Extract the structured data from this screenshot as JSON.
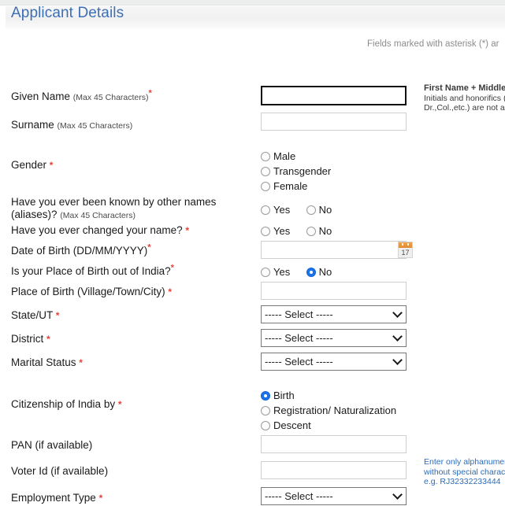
{
  "header": {
    "title": "Applicant Details",
    "asterisk_note": "Fields marked with asterisk (*) ar"
  },
  "hints": {
    "name_hint_title": "First Name + Middle N",
    "name_hint_line1": "Initials and honorifics (e",
    "name_hint_line2": "Dr.,Col.,etc.) are not all",
    "id_hint_line1": "Enter only alphanumeri",
    "id_hint_line2": "without special charact",
    "id_hint_line3": "e.g. RJ32332233444"
  },
  "select_placeholder": "----- Select -----",
  "fields": {
    "given_name": {
      "label": "Given Name",
      "sub": "(Max 45 Characters)",
      "required": true,
      "value": "",
      "focused": true
    },
    "surname": {
      "label": "Surname",
      "sub": "(Max 45 Characters)",
      "required": false,
      "value": ""
    },
    "gender": {
      "label": "Gender",
      "required": true,
      "options": [
        "Male",
        "Transgender",
        "Female"
      ],
      "selected": null
    },
    "aliases": {
      "label": "Have you ever been known by other names (aliases)?",
      "sub": "(Max 45 Characters)",
      "required": false,
      "options": [
        "Yes",
        "No"
      ],
      "selected": null
    },
    "changed_name": {
      "label": "Have you ever changed your name?",
      "required": true,
      "options": [
        "Yes",
        "No"
      ],
      "selected": null
    },
    "dob": {
      "label": "Date of Birth (DD/MM/YYYY)",
      "required": true,
      "value": "",
      "calendar_icon": "calendar-icon",
      "calendar_day": "17"
    },
    "pob_outside_india": {
      "label": "Is your Place of Birth out of India?",
      "required": true,
      "options": [
        "Yes",
        "No"
      ],
      "selected": "No"
    },
    "place_of_birth": {
      "label": "Place of Birth (Village/Town/City)",
      "required": true,
      "value": ""
    },
    "state_ut": {
      "label": "State/UT",
      "required": true,
      "value": "----- Select -----"
    },
    "district": {
      "label": "District",
      "required": true,
      "value": "----- Select -----"
    },
    "marital_status": {
      "label": "Marital Status",
      "required": true,
      "value": "----- Select -----"
    },
    "citizenship": {
      "label": "Citizenship of India by",
      "required": true,
      "options": [
        "Birth",
        "Registration/ Naturalization",
        "Descent"
      ],
      "selected": "Birth"
    },
    "pan": {
      "label": "PAN (if available)",
      "required": false,
      "value": ""
    },
    "voter_id": {
      "label": "Voter Id (if available)",
      "required": false,
      "value": ""
    },
    "employment_type": {
      "label": "Employment Type",
      "required": true,
      "value": "----- Select -----"
    }
  }
}
